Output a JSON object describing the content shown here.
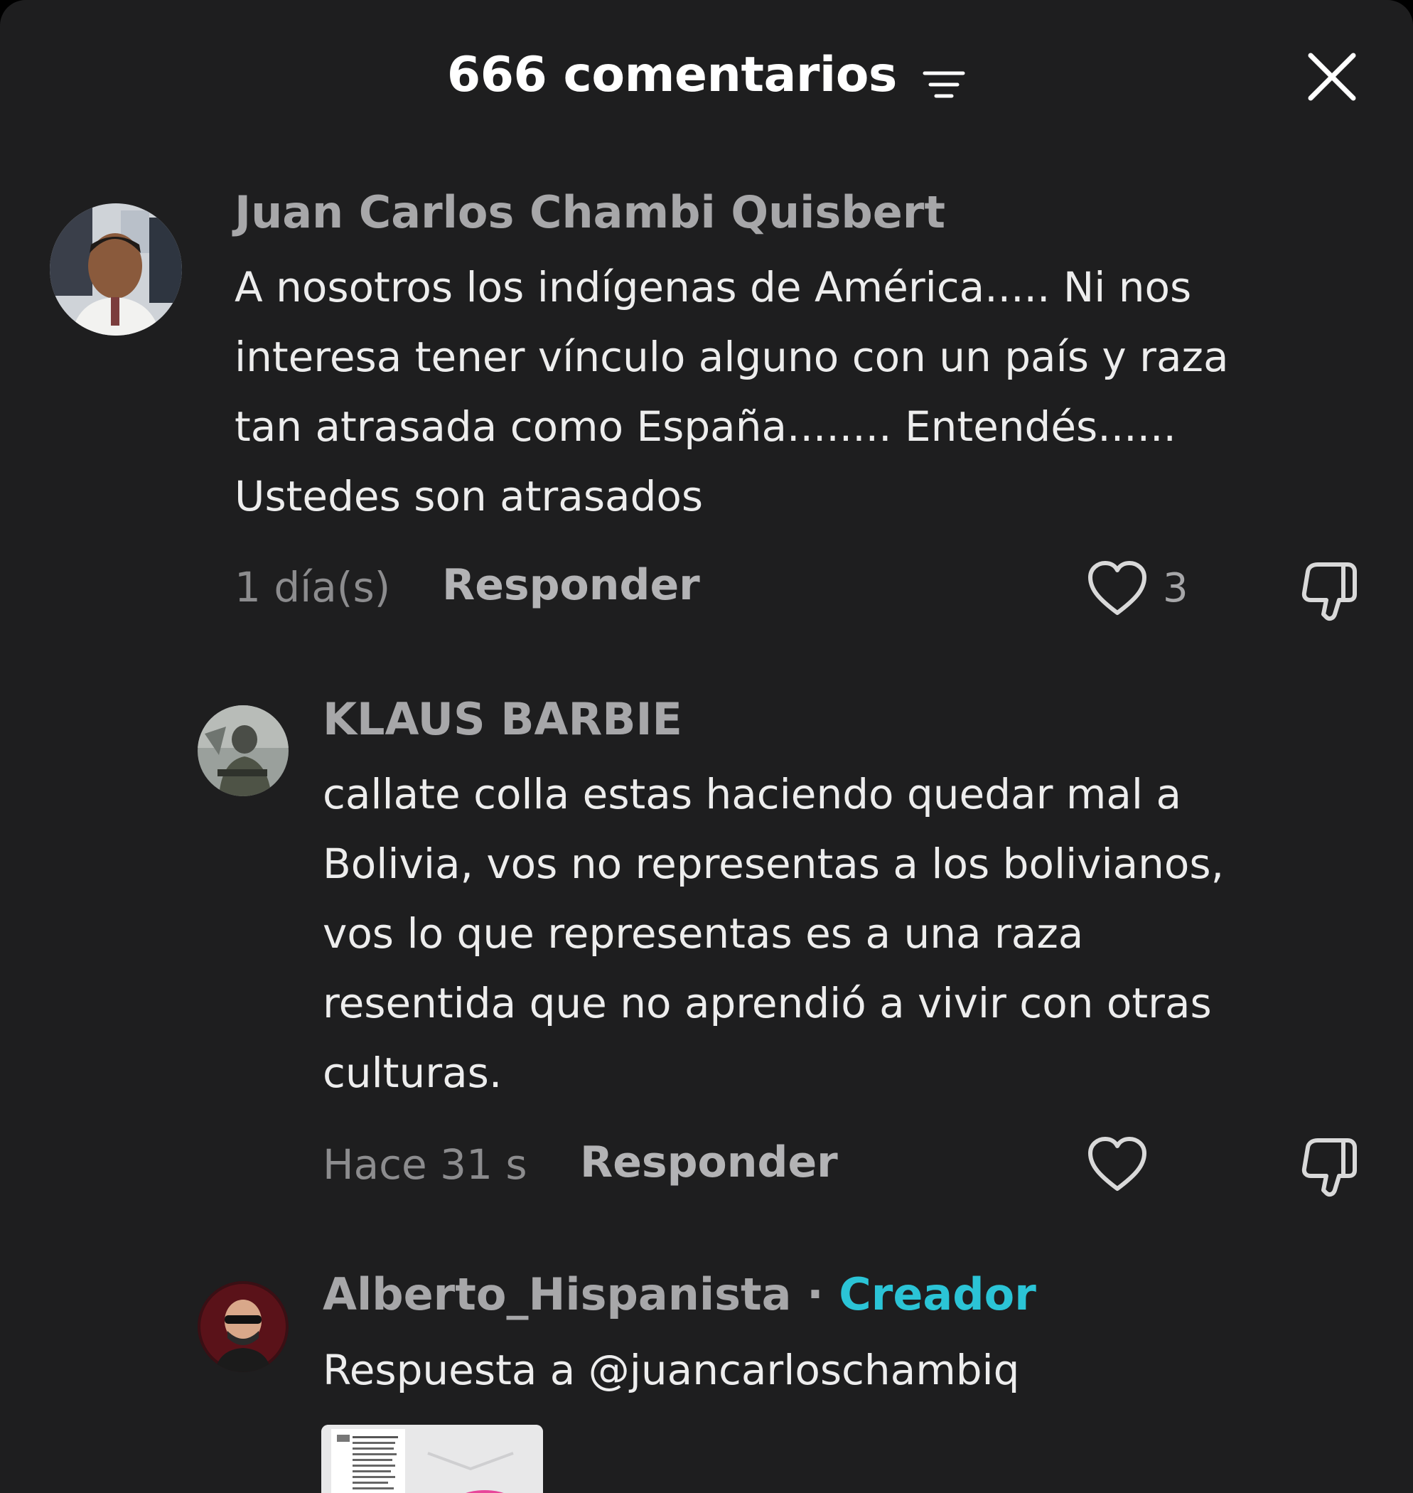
{
  "header": {
    "count": "666",
    "title": "comentarios",
    "filter_icon": "filter-lines-icon",
    "close_icon": "close-x-icon"
  },
  "comments": [
    {
      "username": "Juan Carlos Chambi Quisbert",
      "lines": [
        "A nosotros los indígenas de América..... Ni nos",
        "interesa tener vínculo alguno con un país y raza",
        "tan atrasada como España........ Entendés......",
        "Ustedes son atrasados"
      ],
      "time": "1 día(s)",
      "reply_label": "Responder",
      "likes": "3"
    },
    {
      "username": "KLAUS BARBIE",
      "lines": [
        "callate colla estas haciendo quedar mal a",
        "Bolivia, vos no representas a los bolivianos,",
        "vos lo que representas es a una raza",
        "resentida que no aprendió a vivir con otras",
        "culturas."
      ],
      "time": "Hace 31 s",
      "reply_label": "Responder",
      "likes": ""
    },
    {
      "username": "Alberto_Hispanista",
      "separator": "·",
      "badge": "Creador",
      "text": "Respuesta a @juancarloschambiq"
    }
  ],
  "colors": {
    "background": "#1e1e1f",
    "creator_badge": "#2bc4d6",
    "username": "#a7a7a9",
    "comment_text": "#ededed"
  }
}
